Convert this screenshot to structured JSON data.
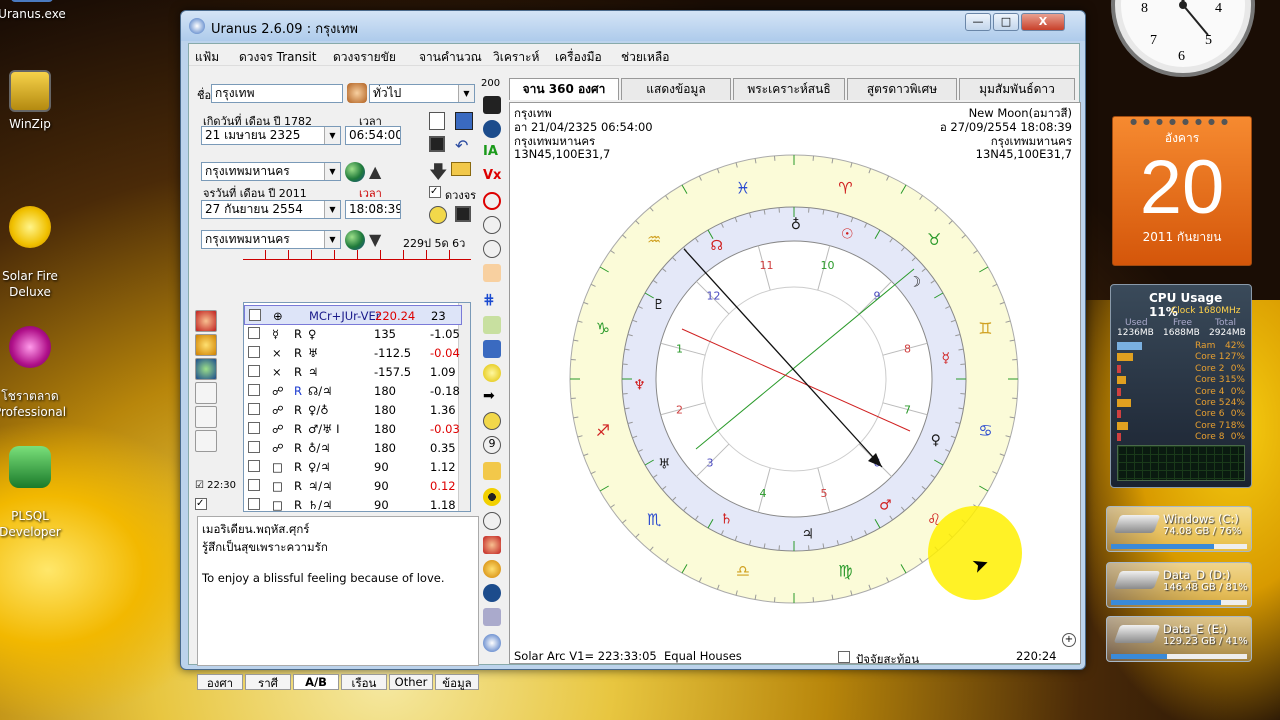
{
  "desktop": {
    "icons": [
      {
        "label": "Uranus.exe"
      },
      {
        "label": "WinZip"
      },
      {
        "label": "Solar Fire\nDeluxe"
      },
      {
        "label": "โชราตลาด\nProfessional"
      },
      {
        "label": "PLSQL\nDeveloper"
      }
    ]
  },
  "window": {
    "title": "Uranus 2.6.09 : กรุงเทพ",
    "controls": {
      "minimize": "—",
      "maximize": "□",
      "close": "X"
    },
    "menu": [
      "แฟ้ม",
      "ดวงจร Transit",
      "ดวงจรายขัย",
      "จานคำนวณ",
      "วิเคราะห์",
      "เครื่องมือ",
      "ช่วยเหลือ"
    ],
    "left": {
      "name_label": "ชื่อ",
      "name_value": "กรุงเทพ",
      "type_value": "ทั่วไป",
      "birth_label": "เกิดวันที่  เดือน  ปี 1782",
      "time_label": "เวลา",
      "birth_date": "21 เมษายน 2325",
      "birth_time": "06:54:00",
      "birth_place": "กรุงเทพมหานคร",
      "transit_label": "จรวันที่  เดือน  ปี 2011",
      "transit_time_label": "เวลา",
      "transit_date": "27 กันยายน 2554",
      "transit_time": "18:08:39",
      "transit_place": "กรุงเทพมหานคร",
      "transit_check": "ดวงจร",
      "age": "229ป 5ด 6ว",
      "side_time": "22:30",
      "aspects": [
        {
          "p": "⊕",
          "r": "",
          "code": "MCr+JUr-VEr",
          "val": "220.24",
          "orb": "23"
        },
        {
          "p": "☿",
          "r": "R",
          "code": "♀",
          "val": "135",
          "orb": "-1.05"
        },
        {
          "p": "×",
          "r": "R",
          "code": "♅",
          "val": "-112.5",
          "orb": "-0.04"
        },
        {
          "p": "×",
          "r": "R",
          "code": "♃",
          "val": "-157.5",
          "orb": "1.09"
        },
        {
          "p": "☍",
          "r": "R",
          "code": "☊/♃",
          "val": "180",
          "orb": "-0.18"
        },
        {
          "p": "☍",
          "r": "R",
          "code": "♀/♁",
          "val": "180",
          "orb": "1.36"
        },
        {
          "p": "☍",
          "r": "R",
          "code": "♂/♅ I",
          "val": "180",
          "orb": "-0.03"
        },
        {
          "p": "☍",
          "r": "R",
          "code": "♁/♃",
          "val": "180",
          "orb": "0.35"
        },
        {
          "p": "□",
          "r": "R",
          "code": "♀/♃",
          "val": "90",
          "orb": "1.12"
        },
        {
          "p": "□",
          "r": "R",
          "code": "♃/♃",
          "val": "90",
          "orb": "0.12"
        },
        {
          "p": "□",
          "r": "R",
          "code": "♄/♃",
          "val": "90",
          "orb": "1.18"
        }
      ],
      "notes_line1": "เมอริเดียน.พฤหัส.ศุกร์",
      "notes_line2": "รู้สึกเป็นสุขเพราะความรัก",
      "notes_line3": "To enjoy a blissful feeling because of love.",
      "bottom_tabs": [
        "องศา",
        "ราศี",
        "A/B",
        "เรือน",
        "Other",
        "ข้อมูล"
      ]
    },
    "tool_zoom": "200",
    "tabs": [
      "จาน 360 องศา",
      "แสดงข้อมูล",
      "พระเคราะห์สนธิ",
      "สูตรดาวพิเศษ",
      "มุมสัมพันธ์ดาว"
    ],
    "chart": {
      "left_info": [
        "กรุงเทพ",
        "อา 21/04/2325 06:54:00",
        "กรุงเทพมหานคร",
        "13N45,100E31,7"
      ],
      "right_info": [
        "New Moon(อมาวสี)",
        "อ 27/09/2554 18:08:39",
        "กรุงเทพมหานคร",
        "13N45,100E31,7"
      ],
      "status_left": "Solar Arc V1= 223:33:05",
      "status_mid": "Equal Houses",
      "status_check": "ปัจจัยสะท้อน",
      "status_right": "220:24",
      "house_numbers": [
        "1",
        "2",
        "3",
        "4",
        "5",
        "6",
        "7",
        "8",
        "9",
        "10",
        "11",
        "12"
      ]
    }
  },
  "calendar": {
    "day_name": "อังคาร",
    "day": "20",
    "month_year": "2011 กันยายน"
  },
  "cpu": {
    "title": "CPU Usage 11%",
    "clock": "Clock 1680MHz",
    "used_label": "Used",
    "free_label": "Free",
    "total_label": "Total",
    "used": "1236MB",
    "free": "1688MB",
    "total": "2924MB",
    "rows": [
      {
        "name": "Ram",
        "val": "42%"
      },
      {
        "name": "Core 1",
        "val": "27%"
      },
      {
        "name": "Core 2",
        "val": "0%"
      },
      {
        "name": "Core 3",
        "val": "15%"
      },
      {
        "name": "Core 4",
        "val": "0%"
      },
      {
        "name": "Core 5",
        "val": "24%"
      },
      {
        "name": "Core 6",
        "val": "0%"
      },
      {
        "name": "Core 7",
        "val": "18%"
      },
      {
        "name": "Core 8",
        "val": "0%"
      }
    ]
  },
  "drives": [
    {
      "name": "Windows (C:)",
      "size": "74.08 GB / 76%",
      "fill": 0.76
    },
    {
      "name": "Data_D (D:)",
      "size": "146.48 GB / 81%",
      "fill": 0.81
    },
    {
      "name": "Data_E (E:)",
      "size": "129.23 GB / 41%",
      "fill": 0.41
    }
  ]
}
